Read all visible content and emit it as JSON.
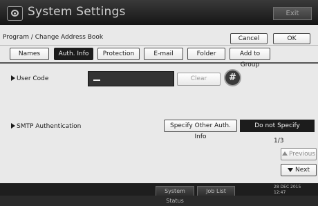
{
  "header": {
    "title": "System Settings",
    "exit_label": "Exit",
    "icon": "system-settings-icon"
  },
  "breadcrumb": {
    "text": "Program / Change Address Book",
    "cancel_label": "Cancel",
    "ok_label": "OK"
  },
  "tabs": [
    {
      "label": "Names",
      "active": false
    },
    {
      "label": "Auth. Info",
      "active": true
    },
    {
      "label": "Protection",
      "active": false
    },
    {
      "label": "E-mail",
      "active": false
    },
    {
      "label": "Folder",
      "active": false
    },
    {
      "label": "Add to Group",
      "active": false
    }
  ],
  "user_code": {
    "label": "User Code",
    "value": "",
    "clear_label": "Clear",
    "hash_label": "#"
  },
  "smtp": {
    "label": "SMTP Authentication",
    "specify_other_label": "Specify Other Auth. Info",
    "selected_label": "Do not Specify"
  },
  "pager": {
    "page_count": "1/3",
    "previous_label": "Previous",
    "next_label": "Next"
  },
  "status_bar": {
    "system_status_label": "System Status",
    "job_list_label": "Job List",
    "date": "28 DEC  2015",
    "time": "12:47"
  },
  "colors": {
    "active_tab": "#1c1c1c",
    "background": "#e9e9e9",
    "titlebar": "#1a1a1a"
  }
}
